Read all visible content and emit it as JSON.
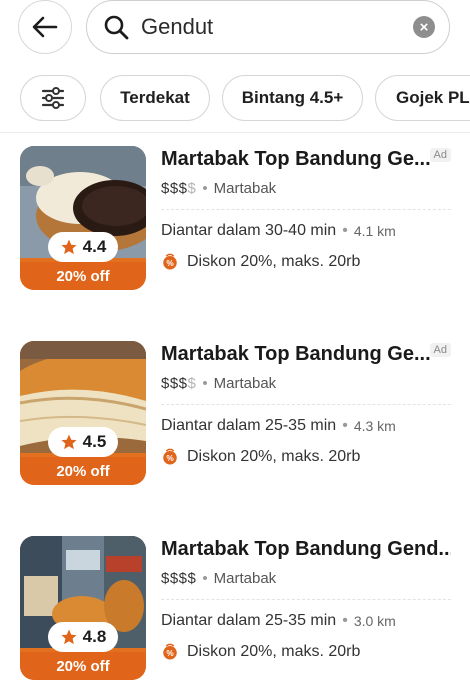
{
  "search": {
    "query": "Gendut"
  },
  "filters": {
    "chips": [
      "Terdekat",
      "Bintang 4.5+",
      "Gojek PLUS"
    ]
  },
  "results": [
    {
      "name": "Martabak Top Bandung Ge...",
      "ad_label": "Ad",
      "price_active": "$$$",
      "price_dim": "$",
      "category": "Martabak",
      "delivery": "Diantar dalam 30-40 min",
      "distance": "4.1 km",
      "promo": "Diskon 20%, maks. 20rb",
      "rating": "4.4",
      "discount_badge": "20% off"
    },
    {
      "name": "Martabak Top Bandung Ge...",
      "ad_label": "Ad",
      "price_active": "$$$",
      "price_dim": "$",
      "category": "Martabak",
      "delivery": "Diantar dalam 25-35 min",
      "distance": "4.3 km",
      "promo": "Diskon 20%, maks. 20rb",
      "rating": "4.5",
      "discount_badge": "20% off"
    },
    {
      "name": "Martabak Top Bandung Gend...",
      "ad_label": "",
      "price_active": "$$$$",
      "price_dim": "",
      "category": "Martabak",
      "delivery": "Diantar dalam 25-35 min",
      "distance": "3.0 km",
      "promo": "Diskon 20%, maks. 20rb",
      "rating": "4.8",
      "discount_badge": "20% off"
    }
  ],
  "colors": {
    "accent": "#e0641a",
    "star": "#e0641a"
  }
}
